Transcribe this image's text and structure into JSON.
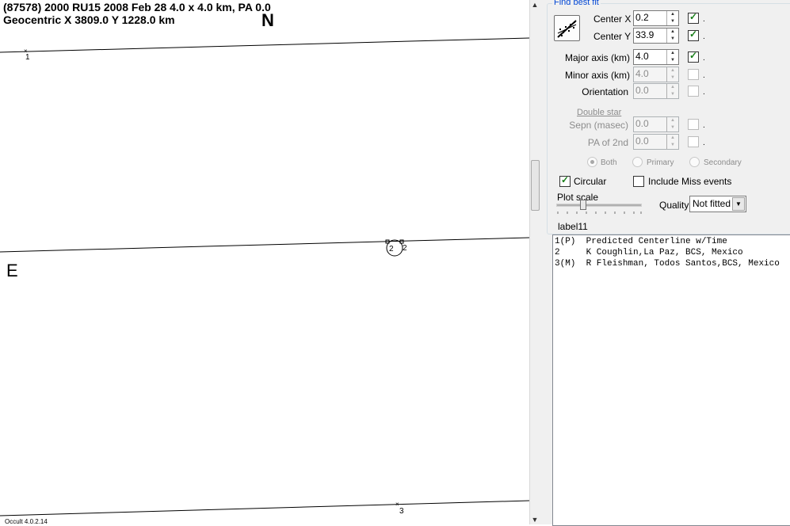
{
  "header": {
    "line1": "(87578) 2000 RU15  2008 Feb 28   4.0 x 4.0 km, PA 0.0",
    "line2": "Geocentric  X  3809.0  Y  1228.0 km"
  },
  "plot": {
    "north_label": "N",
    "east_label": "E",
    "chord_labels": [
      "1",
      "2",
      "2",
      "3"
    ],
    "version": "Occult 4.0.2.14"
  },
  "fit": {
    "legend": "Find best fit",
    "fit_button_icon": "chart-fit-icon",
    "center_x": {
      "label": "Center X",
      "value": "0.2",
      "checked": true
    },
    "center_y": {
      "label": "Center Y",
      "value": "33.9",
      "checked": true
    },
    "major_axis": {
      "label": "Major axis (km)",
      "value": "4.0",
      "checked": true
    },
    "minor_axis": {
      "label": "Minor axis (km)",
      "value": "4.0",
      "checked": false
    },
    "orientation": {
      "label": "Orientation",
      "value": "0.0",
      "checked": false
    },
    "double_star": "Double star",
    "sepn": {
      "label": "Sepn (masec)",
      "value": "0.0",
      "checked": false
    },
    "pa2": {
      "label": "PA of 2nd",
      "value": "0.0",
      "checked": false
    },
    "radio": [
      "Both",
      "Primary",
      "Secondary"
    ],
    "radio_selected": "Both",
    "dot": "."
  },
  "options": {
    "circular_label": "Circular",
    "circular_checked": true,
    "miss_label": "Include Miss events",
    "miss_checked": false,
    "plot_scale_label": "Plot scale",
    "plot_scale_level": 0.3,
    "quality_label": "Quality",
    "quality_value": "Not fitted",
    "label11": "label11"
  },
  "events": [
    "1(P)  Predicted Centerline w/Time",
    "2     K Coughlin,La Paz, BCS, Mexico",
    "3(M)  R Fleishman, Todos Santos,BCS, Mexico"
  ],
  "colors": {
    "accent": "#0046d5",
    "check": "#1a7f1a",
    "panel": "#f0f0f0"
  }
}
